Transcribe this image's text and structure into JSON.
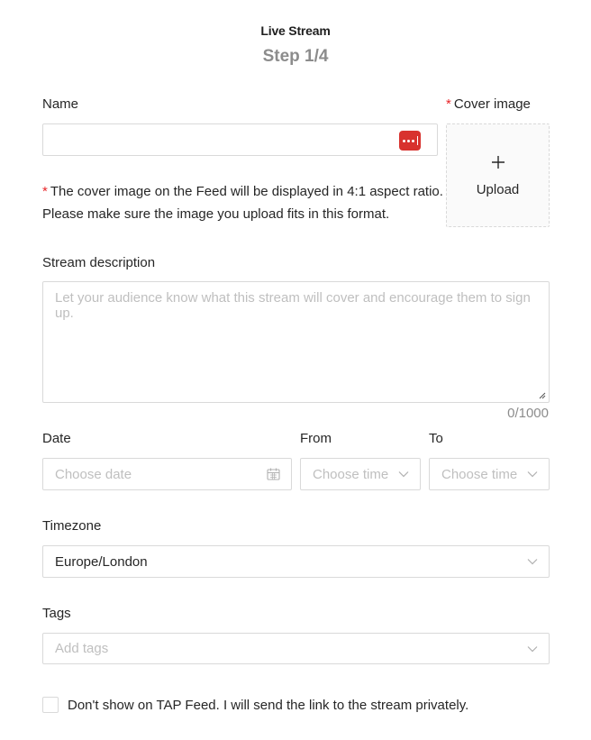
{
  "header": {
    "title": "Live Stream",
    "step": "Step 1/4"
  },
  "name": {
    "label": "Name",
    "value": ""
  },
  "cover": {
    "required_mark": "*",
    "label": "Cover image",
    "upload_label": "Upload"
  },
  "note": {
    "required_mark": "*",
    "line1": "The cover image on the Feed will be displayed in 4:1 aspect ratio.",
    "line2": "Please make sure the image you upload fits in this format."
  },
  "description": {
    "label": "Stream description",
    "placeholder": "Let your audience know what this stream will cover and encourage them to sign up.",
    "counter": "0/1000"
  },
  "date": {
    "label": "Date",
    "placeholder": "Choose date"
  },
  "from": {
    "label": "From",
    "placeholder": "Choose time"
  },
  "to": {
    "label": "To",
    "placeholder": "Choose time"
  },
  "timezone": {
    "label": "Timezone",
    "value": "Europe/London"
  },
  "tags": {
    "label": "Tags",
    "placeholder": "Add tags"
  },
  "private_option": {
    "label": "Don't show on TAP Feed. I will send the link to the stream privately.",
    "checked": false
  },
  "icons": {
    "password_manager": "password-manager-icon",
    "calendar": "calendar-icon",
    "chevron": "chevron-down-icon",
    "plus": "plus-icon"
  },
  "colors": {
    "required": "#e8262a",
    "password_icon": "#d8322e",
    "border": "#d9d9d9",
    "placeholder": "#bfbfbf"
  }
}
